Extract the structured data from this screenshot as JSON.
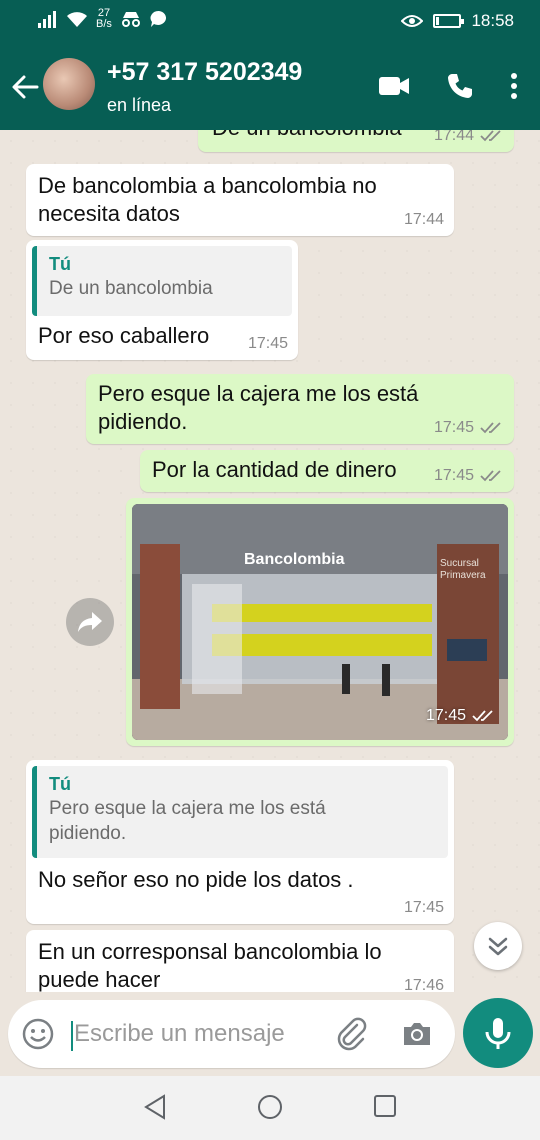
{
  "status_bar": {
    "net_speed_value": "27",
    "net_speed_unit": "B/s",
    "time": "18:58",
    "battery_level": 0.15
  },
  "header": {
    "contact_name": "+57 317 5202349",
    "contact_status": "en línea"
  },
  "messages": [
    {
      "type": "out",
      "text": "De un bancolombia",
      "time": "17:44",
      "ticks": "read",
      "partial": true
    },
    {
      "type": "in",
      "lines": [
        "De bancolombia a bancolombia no",
        "necesita datos"
      ],
      "time": "17:44"
    },
    {
      "type": "in",
      "quote_author": "Tú",
      "quote_text": "De un bancolombia",
      "text": "Por eso caballero",
      "time": "17:45"
    },
    {
      "type": "out",
      "lines": [
        "Pero esque la cajera me los está",
        "pidiendo."
      ],
      "time": "17:45",
      "ticks": "read"
    },
    {
      "type": "out",
      "text": "Por la cantidad de dinero",
      "time": "17:45",
      "ticks": "read"
    },
    {
      "type": "out-image",
      "sign_text": "Bancolombia",
      "sign_subtext": [
        "Sucursal",
        "Primavera"
      ],
      "time": "17:45",
      "ticks": "read"
    },
    {
      "type": "in",
      "quote_author": "Tú",
      "quote_lines": [
        "Pero esque la cajera me los está",
        "pidiendo."
      ],
      "text": "No señor eso no pide los datos .",
      "time": "17:45"
    },
    {
      "type": "in",
      "lines": [
        "En un corresponsal bancolombia lo",
        "puede hacer"
      ],
      "time": "17:46",
      "partial": true
    }
  ],
  "composer": {
    "placeholder": "Escribe un mensaje"
  },
  "colors": {
    "header": "#075e54",
    "accent": "#128c7e",
    "outgoing_bubble": "#dcf8c6",
    "incoming_bubble": "#ffffff",
    "read_ticks": "#4fc3f7"
  },
  "icons": [
    "signal-icon",
    "wifi-icon",
    "incognito-icon",
    "chat-notification-icon",
    "eye-icon",
    "battery-icon",
    "back-arrow-icon",
    "video-call-icon",
    "phone-icon",
    "more-menu-icon",
    "forward-icon",
    "scroll-down-icon",
    "emoji-icon",
    "attach-icon",
    "camera-icon",
    "mic-icon",
    "nav-back-icon",
    "nav-home-icon",
    "nav-recents-icon"
  ]
}
